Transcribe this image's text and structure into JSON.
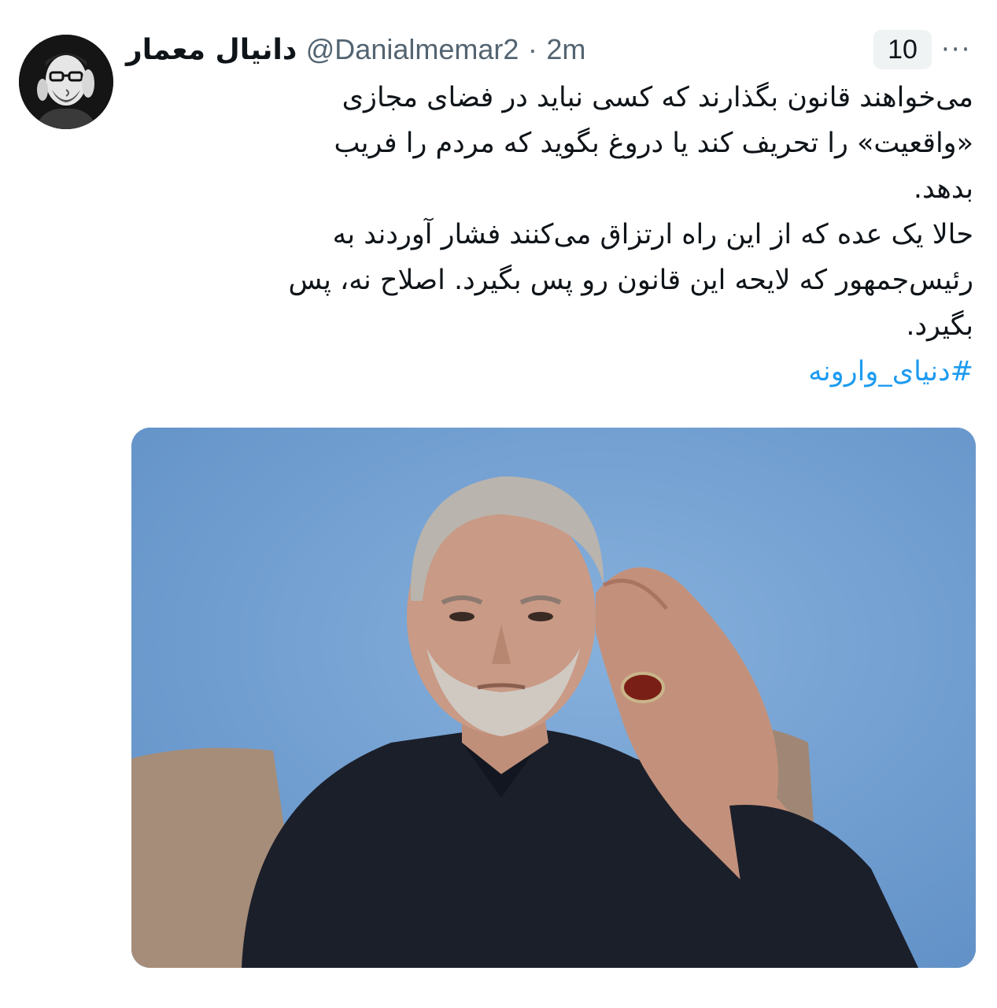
{
  "author": {
    "display_name": "دانیال معمار",
    "handle": "@Danialmemar2",
    "separator": "·",
    "time": "2m",
    "avatar_icon": "profile-photo"
  },
  "header": {
    "count_badge": "10",
    "more_icon": "more-horizontal-icon",
    "more_label": "···"
  },
  "tweet": {
    "lines": [
      "می‌خواهند قانون بگذارند که کسی نباید در فضای مجازی",
      "«واقعیت» را تحریف کند یا دروغ بگوید که مردم را فریب",
      "بدهد.",
      "حالا یک عده که از این راه ارتزاق می‌کنند فشار آوردند به",
      "رئیس‌جمهور که لایحه این قانون رو پس بگیرد. اصلاح نه، پس",
      "بگیرد."
    ],
    "hashtag": "#دنیای_وارونه"
  },
  "media": {
    "description_icon": "photo-man-hand-on-head",
    "colors": {
      "background": "#6d9cd0",
      "jacket": "#1b1f2a",
      "skin": "#c99a85",
      "hair": "#b9b4ad",
      "chair": "#a98f7a"
    }
  },
  "colors": {
    "text": "#0f1419",
    "secondary": "#536471",
    "link": "#1d9bf0",
    "badge_bg": "#eff3f4"
  }
}
